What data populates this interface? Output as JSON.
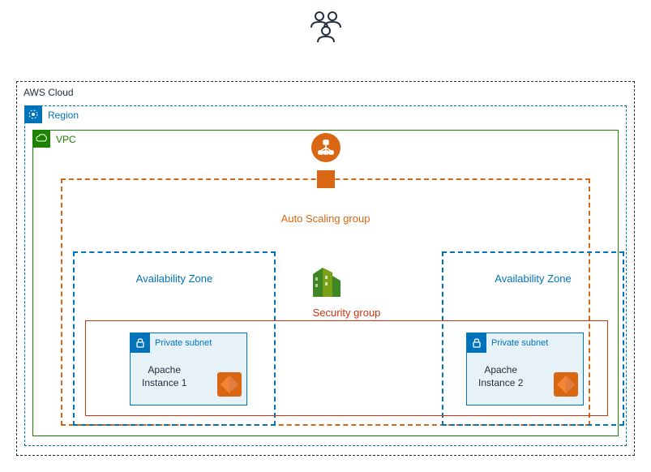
{
  "diagram": {
    "title": "AWS Cloud",
    "region_label": "Region",
    "vpc_label": "VPC",
    "asg_label": "Auto Scaling group",
    "az_label": "Availability Zone",
    "sg_label": "Security group",
    "subnet_label": "Private subnet",
    "instances": [
      {
        "name": "Apache Instance 1"
      },
      {
        "name": "Apache Instance 2"
      }
    ]
  }
}
